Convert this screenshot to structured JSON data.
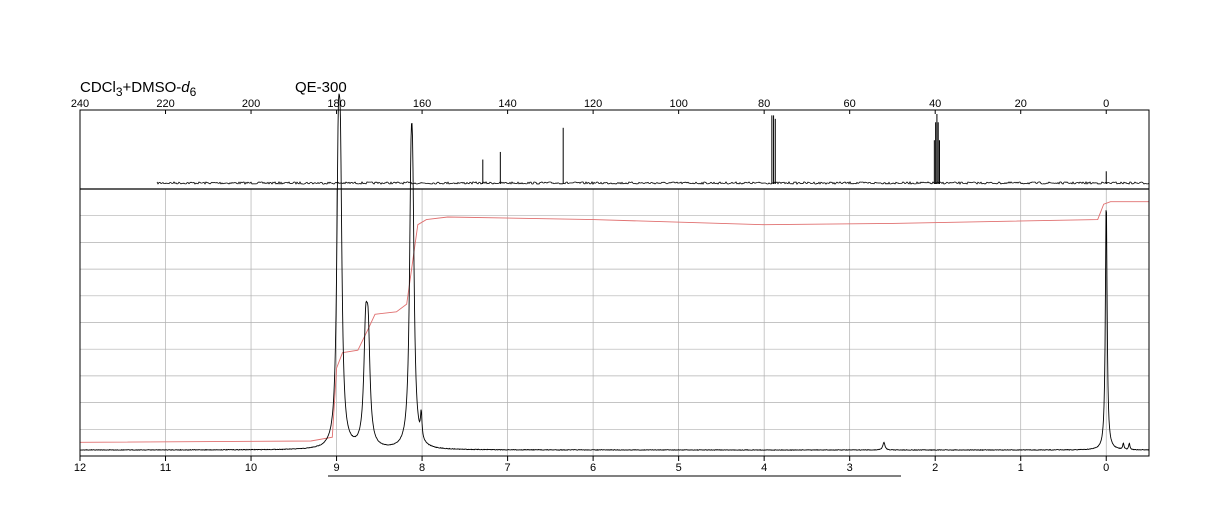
{
  "chart_data": [
    {
      "type": "line",
      "name": "13C NMR spectrum",
      "title_solvent": "CDCl3+DMSO-d6",
      "solvent_parts": {
        "pre": "CDCl",
        "sub1": "3",
        "mid": "+DMSO-",
        "italic": "d",
        "sub2": "6"
      },
      "instrument": "QE-300",
      "xlabel": "",
      "ylabel": "",
      "x_range": [
        240,
        -10
      ],
      "x_ticks": [
        240,
        220,
        200,
        180,
        160,
        140,
        120,
        100,
        80,
        60,
        40,
        20,
        0
      ],
      "tick_position": "top",
      "peaks": [
        {
          "x": 145.8,
          "height": 0.34
        },
        {
          "x": 141.7,
          "height": 0.45
        },
        {
          "x": 127.0,
          "height": 0.8
        },
        {
          "x": 78.2,
          "height": 0.98
        },
        {
          "x": 77.8,
          "height": 0.98
        },
        {
          "x": 77.4,
          "height": 0.93
        },
        {
          "x": 40.2,
          "height": 0.62
        },
        {
          "x": 39.9,
          "height": 0.88
        },
        {
          "x": 39.6,
          "height": 1.0
        },
        {
          "x": 39.3,
          "height": 0.88
        },
        {
          "x": 39.0,
          "height": 0.62
        },
        {
          "x": 0.0,
          "height": 0.17
        }
      ]
    },
    {
      "type": "line",
      "name": "1H NMR spectrum",
      "xlabel": "",
      "ylabel": "",
      "x_range": [
        12,
        -0.5
      ],
      "x_ticks": [
        12,
        11,
        10,
        9,
        8,
        7,
        6,
        5,
        4,
        3,
        2,
        1,
        0
      ],
      "tick_position": "bottom",
      "grid": true,
      "y_gridlines": 10,
      "peaks": [
        {
          "x": 8.98,
          "height": 0.95,
          "width": 0.022
        },
        {
          "x": 8.955,
          "height": 0.9,
          "width": 0.022
        },
        {
          "x": 8.66,
          "height": 0.4,
          "width": 0.025
        },
        {
          "x": 8.63,
          "height": 0.38,
          "width": 0.025
        },
        {
          "x": 8.13,
          "height": 0.8,
          "width": 0.022
        },
        {
          "x": 8.11,
          "height": 0.76,
          "width": 0.022
        },
        {
          "x": 8.01,
          "height": 0.1,
          "width": 0.01
        },
        {
          "x": 2.6,
          "height": 0.03,
          "width": 0.015
        },
        {
          "x": 0.0,
          "height": 1.0,
          "width": 0.012
        },
        {
          "x": -0.2,
          "height": 0.025,
          "width": 0.008
        },
        {
          "x": -0.27,
          "height": 0.025,
          "width": 0.008
        }
      ],
      "integral": {
        "color": "#e07070",
        "points": [
          [
            12,
            0.03
          ],
          [
            9.3,
            0.035
          ],
          [
            9.05,
            0.05
          ],
          [
            9.0,
            0.32
          ],
          [
            8.93,
            0.38
          ],
          [
            8.75,
            0.39
          ],
          [
            8.62,
            0.48
          ],
          [
            8.55,
            0.53
          ],
          [
            8.3,
            0.54
          ],
          [
            8.18,
            0.57
          ],
          [
            8.05,
            0.88
          ],
          [
            7.95,
            0.9
          ],
          [
            7.7,
            0.91
          ],
          [
            6.0,
            0.9
          ],
          [
            4.0,
            0.88
          ],
          [
            2.5,
            0.885
          ],
          [
            0.1,
            0.9
          ],
          [
            0.03,
            0.96
          ],
          [
            -0.05,
            0.97
          ],
          [
            -0.5,
            0.97
          ]
        ]
      },
      "range_bar": [
        9.1,
        2.4
      ]
    }
  ],
  "colors": {
    "spectrum": "#000000",
    "grid": "#b0b0b0",
    "integral": "#e07070"
  }
}
